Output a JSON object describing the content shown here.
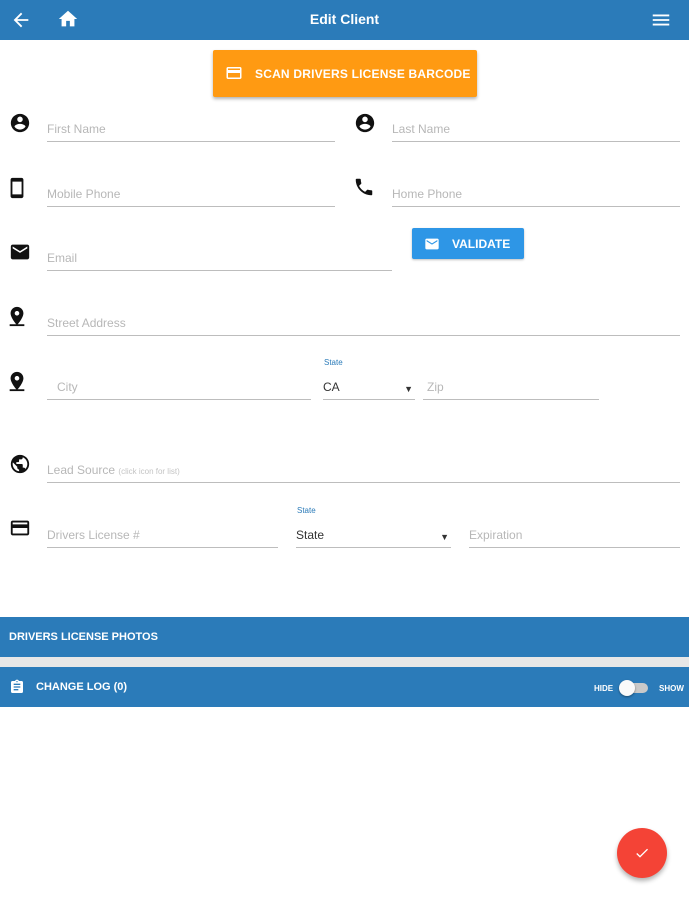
{
  "appbar": {
    "title": "Edit Client",
    "back_icon": "arrow-back-icon",
    "home_icon": "home-icon",
    "menu_icon": "hamburger-menu-icon"
  },
  "scan_button": {
    "label": "SCAN DRIVERS LICENSE BARCODE",
    "icon": "credit-card-icon",
    "color": "#ff9a12"
  },
  "form": {
    "first_name": {
      "placeholder": "First Name",
      "icon": "account-circle-icon"
    },
    "last_name": {
      "placeholder": "Last Name",
      "icon": "account-circle-icon"
    },
    "mobile_phone": {
      "placeholder": "Mobile Phone",
      "icon": "smartphone-icon"
    },
    "home_phone": {
      "placeholder": "Home Phone",
      "icon": "phone-icon"
    },
    "email": {
      "placeholder": "Email",
      "icon": "mail-icon"
    },
    "validate_label": "VALIDATE",
    "street": {
      "placeholder": "Street Address",
      "icon": "place-icon"
    },
    "city": {
      "placeholder": "City",
      "icon": "place-icon"
    },
    "state": {
      "label": "State",
      "value": "CA"
    },
    "zip": {
      "placeholder": "Zip"
    },
    "lead_source": {
      "placeholder": "Lead Source",
      "hint": "(click icon for list)",
      "icon": "globe-icon"
    },
    "license_number": {
      "placeholder": "Drivers License #",
      "icon": "credit-card-icon"
    },
    "license_state": {
      "label": "State",
      "value": "State"
    },
    "expiration": {
      "placeholder": "Expiration"
    }
  },
  "sections": {
    "photos": "DRIVERS LICENSE PHOTOS",
    "change_log": "CHANGE LOG (0)",
    "hide": "HIDE",
    "show": "SHOW"
  },
  "colors": {
    "primary": "#2b7bb9",
    "accent": "#2e96e6",
    "fab": "#f44336"
  },
  "fab_icon": "check-icon"
}
